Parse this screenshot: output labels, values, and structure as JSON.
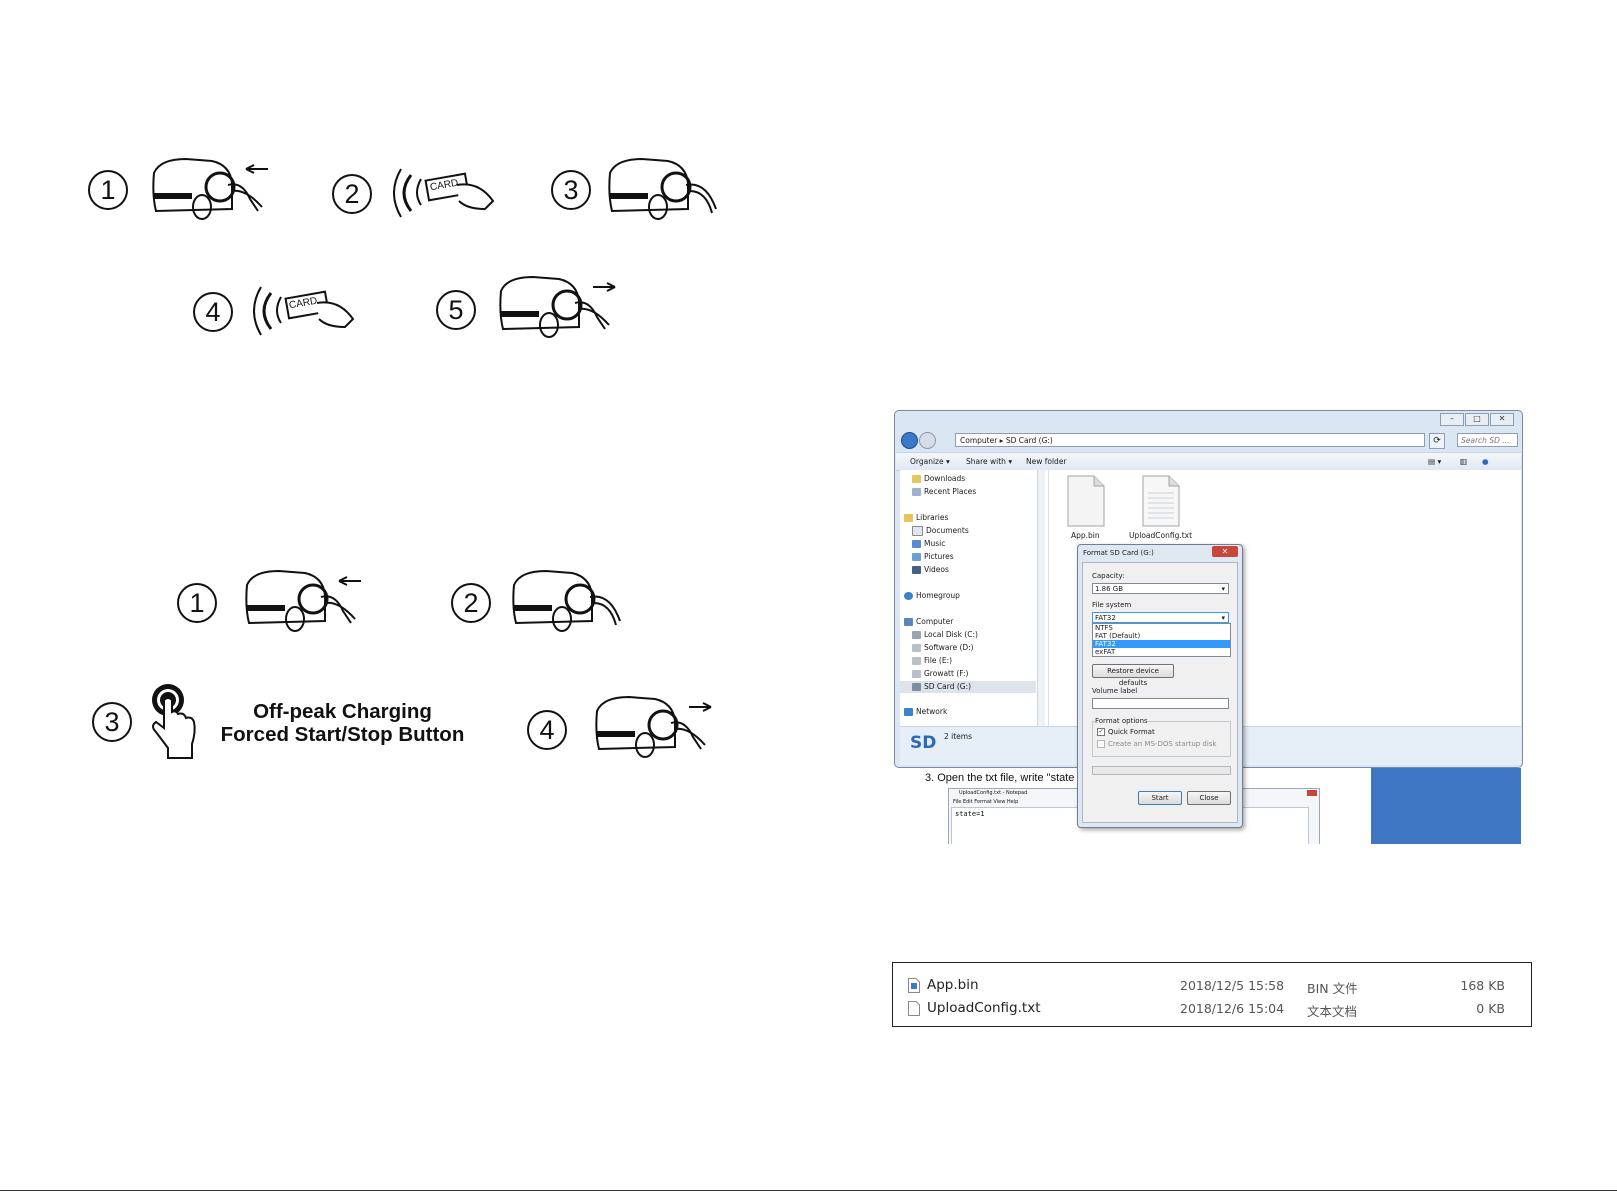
{
  "top_steps": {
    "numbers": [
      "1",
      "2",
      "3",
      "4",
      "5"
    ],
    "card_label": "CARD"
  },
  "bottom_steps": {
    "numbers": [
      "1",
      "2",
      "3",
      "4"
    ],
    "button_caption_line1": "Off-peak Charging",
    "button_caption_line2": "Forced Start/Stop Button"
  },
  "explorer": {
    "address": "Computer ▸ SD Card (G:)",
    "search_placeholder": "Search SD ...",
    "toolbar": {
      "organize": "Organize ▾",
      "share_with": "Share with ▾",
      "new_folder": "New folder"
    },
    "nav_items": [
      "Downloads",
      "Recent Places",
      "Libraries",
      "Documents",
      "Music",
      "Pictures",
      "Videos",
      "Homegroup",
      "Computer",
      "Local Disk (C:)",
      "Software (D:)",
      "File (E:)",
      "Growatt (F:)",
      "SD Card (G:)",
      "Network"
    ],
    "files": [
      "App.bin",
      "UploadConfig.txt"
    ],
    "status_logo": "SD",
    "status_text": "2 items",
    "instruction": "3.  Open the txt file, write \"state",
    "notepad": {
      "title": "UploadConfig.txt - Notepad",
      "menu": "File  Edit  Format  View  Help",
      "content": "state=1"
    }
  },
  "format_dialog": {
    "title": "Format SD Card (G:)",
    "close": "✕",
    "capacity_label": "Capacity:",
    "capacity_value": "1.86 GB",
    "fs_label": "File system",
    "fs_value": "FAT32",
    "fs_options": [
      "NTFS",
      "FAT (Default)",
      "FAT32",
      "exFAT"
    ],
    "fs_selected_index": 2,
    "restore_button": "Restore device defaults",
    "volume_label": "Volume label",
    "format_options_label": "Format options",
    "quick_format": "Quick Format",
    "quick_format_checked": true,
    "msdos_option": "Create an MS-DOS startup disk",
    "start_button": "Start",
    "close_button": "Close"
  },
  "file_listing": [
    {
      "name": "App.bin",
      "date": "2018/12/5 15:58",
      "type": "BIN 文件",
      "size": "168 KB"
    },
    {
      "name": "UploadConfig.txt",
      "date": "2018/12/6 15:04",
      "type": "文本文档",
      "size": "0 KB"
    }
  ],
  "colors": {
    "accent_blue": "#3f76c4",
    "selection": "#3399ff"
  }
}
